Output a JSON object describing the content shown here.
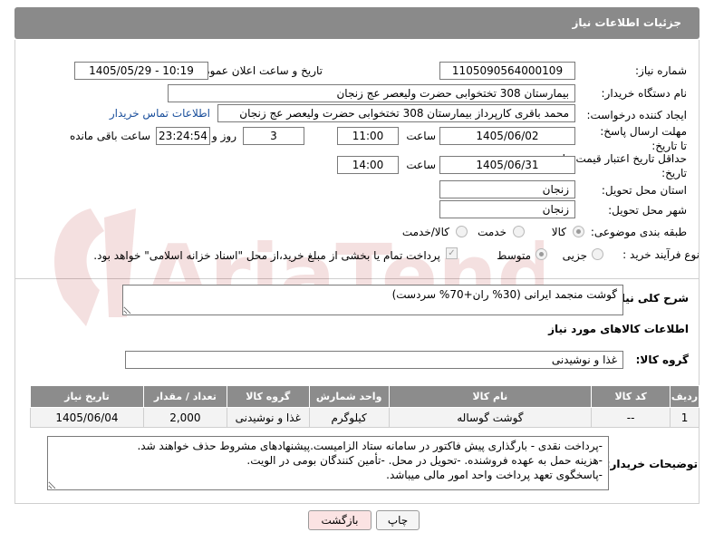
{
  "header": {
    "title": "جزئیات اطلاعات نیاز"
  },
  "fields": {
    "need_number_label": "شماره نیاز:",
    "need_number": "1105090564000109",
    "announce_label": "تاریخ و ساعت اعلان عمومی:",
    "announce_value": "1405/05/29 - 10:19",
    "buyer_org_label": "نام دستگاه خریدار:",
    "buyer_org": "بیمارستان 308 تختخوابی حضرت ولیعصر عج  زنجان",
    "requester_label": "ایجاد کننده درخواست:",
    "requester": "محمد باقری کارپرداز بیمارستان 308 تختخوابی حضرت ولیعصر عج  زنجان",
    "buyer_contact_link": "اطلاعات تماس خریدار",
    "deadline_label": "مهلت ارسال پاسخ: تا تاریخ:",
    "deadline_date": "1405/06/02",
    "time_label": "ساعت",
    "deadline_time": "11:00",
    "days_count": "3",
    "days_label": "روز و",
    "remaining_time": "23:24:54",
    "remaining_label": "ساعت باقی مانده",
    "price_validity_label": "حداقل تاریخ اعتبار قیمت: تا تاریخ:",
    "price_validity_date": "1405/06/31",
    "price_validity_time": "14:00",
    "province_label": "استان محل تحویل:",
    "province": "زنجان",
    "city_label": "شهر محل تحویل:",
    "city": "زنجان",
    "category_label": "طبقه بندی موضوعی:",
    "category_options": [
      "کالا",
      "خدمت",
      "کالا/خدمت"
    ],
    "process_label": "نوع فرآیند خرید :",
    "process_options": [
      "جزیی",
      "متوسط"
    ],
    "payment_note": "پرداخت تمام یا بخشی از مبلغ خرید،از محل \"اسناد خزانه اسلامی\" خواهد بود."
  },
  "summary": {
    "label": "شرح کلی نیاز:",
    "value": "گوشت منجمد ایرانی (30% ران+70% سردست)"
  },
  "goods": {
    "section_title": "اطلاعات کالاهای مورد نیاز",
    "group_label": "گروه کالا:",
    "group_value": "غذا و نوشیدنی",
    "columns": [
      "ردیف",
      "کد کالا",
      "نام کالا",
      "واحد شمارش",
      "گروه کالا",
      "تعداد / مقدار",
      "تاریخ نیاز"
    ],
    "rows": [
      [
        "1",
        "--",
        "گوشت گوساله",
        "کیلوگرم",
        "غذا و نوشیدنی",
        "2,000",
        "1405/06/04"
      ]
    ]
  },
  "buyer_notes": {
    "label": "توضیحات خریدار:",
    "text": "-پرداخت نقدی - بارگذاری پیش فاکتور در سامانه ستاد الزامیست.پیشنهادهای مشروط حذف خواهند شد.\n-هزینه حمل به عهده فروشنده. -تحویل در محل. -تأمین کنندگان بومی در الویت.\n-پاسخگوی تعهد پرداخت واحد امور مالی میباشد."
  },
  "buttons": {
    "print": "چاپ",
    "back": "بازگشت"
  },
  "watermark": "AriaTender.net",
  "colors": {
    "header_bg": "#8a8a8a",
    "table_header_bg": "#8c8c8c",
    "link": "#1a4f9c",
    "back_button_bg": "#fbe3e3"
  }
}
